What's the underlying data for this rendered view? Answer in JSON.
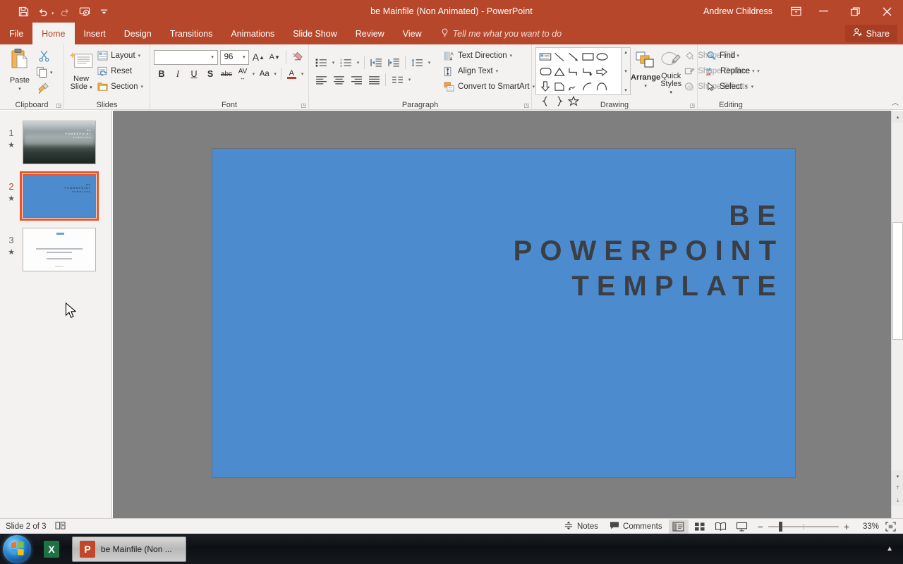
{
  "titlebar": {
    "quick_access": [
      {
        "name": "save-icon",
        "label": "Save"
      },
      {
        "name": "undo-icon",
        "label": "Undo"
      },
      {
        "name": "redo-icon",
        "label": "Redo"
      },
      {
        "name": "start-slideshow-icon",
        "label": "Start From Beginning"
      },
      {
        "name": "customize-qat-icon",
        "label": "Customize Quick Access Toolbar"
      }
    ],
    "document_title": "be Mainfile (Non Animated)",
    "separator": "-",
    "app_name": "PowerPoint",
    "user_name": "Andrew Childress",
    "ribbon_display_options": "Ribbon Display Options",
    "minimize": "Minimize",
    "restore": "Restore Down",
    "close": "Close",
    "accent_color": "#b7472a"
  },
  "tabs": [
    {
      "label": "File",
      "active": false
    },
    {
      "label": "Home",
      "active": true
    },
    {
      "label": "Insert",
      "active": false
    },
    {
      "label": "Design",
      "active": false
    },
    {
      "label": "Transitions",
      "active": false
    },
    {
      "label": "Animations",
      "active": false
    },
    {
      "label": "Slide Show",
      "active": false
    },
    {
      "label": "Review",
      "active": false
    },
    {
      "label": "View",
      "active": false
    }
  ],
  "tell_me": {
    "text": "Tell me what you want to do"
  },
  "share": {
    "label": "Share"
  },
  "ribbon": {
    "clipboard": {
      "group_label": "Clipboard",
      "paste_label": "Paste",
      "cut_label": "Cut",
      "copy_label": "Copy",
      "format_painter_label": "Format Painter"
    },
    "slides": {
      "group_label": "Slides",
      "new_slide_label": "New\nSlide",
      "new_slide_line1": "New",
      "new_slide_line2": "Slide",
      "layout_label": "Layout",
      "reset_label": "Reset",
      "section_label": "Section"
    },
    "font": {
      "group_label": "Font",
      "font_name_value": "",
      "font_size_value": "96",
      "increase_font_label": "A",
      "decrease_font_label": "A",
      "clear_formatting_label": "Clear All Formatting",
      "bold": "B",
      "italic": "I",
      "underline": "U",
      "shadow": "S",
      "strikethrough": "abc",
      "character_spacing": "AV",
      "change_case": "Aa",
      "font_color": "A"
    },
    "paragraph": {
      "group_label": "Paragraph",
      "text_direction_label": "Text Direction",
      "align_text_label": "Align Text",
      "convert_smartart_label": "Convert to SmartArt"
    },
    "drawing": {
      "group_label": "Drawing",
      "arrange_label": "Arrange",
      "quick_styles_line1": "Quick",
      "quick_styles_line2": "Styles",
      "shape_fill_label": "Shape Fill",
      "shape_outline_label": "Shape Outline",
      "shape_effects_label": "Shape Effects"
    },
    "editing": {
      "group_label": "Editing",
      "find_label": "Find",
      "replace_label": "Replace",
      "select_label": "Select"
    },
    "collapse_label": "Collapse the Ribbon"
  },
  "thumbnails": [
    {
      "number": "1",
      "star": "★",
      "selected": false,
      "line1": "BE",
      "line2": "POWERPOINT",
      "line3": "TEMPLATE"
    },
    {
      "number": "2",
      "star": "★",
      "selected": true,
      "line1": "BE",
      "line2": "POWERPOINT",
      "line3": "TEMPLATE"
    },
    {
      "number": "3",
      "star": "★",
      "selected": false,
      "line1": "",
      "line2": "",
      "line3": ""
    }
  ],
  "slide": {
    "background_color": "#4d8bcf",
    "text_color": "#3b3e43",
    "line1": "BE",
    "line2": "POWERPOINT",
    "line3": "TEMPLATE"
  },
  "statusbar": {
    "slide_indicator": "Slide 2 of 3",
    "accessibility_icon": "notes-page-icon",
    "notes_label": "Notes",
    "comments_label": "Comments",
    "view_normal": "Normal View",
    "view_slide_sorter": "Slide Sorter",
    "view_reading": "Reading View",
    "view_slideshow": "Slide Show",
    "zoom_out": "−",
    "zoom_in": "+",
    "zoom_level": "33%",
    "fit_to_window": "Fit slide to current window"
  },
  "taskbar": {
    "start_label": "Start",
    "items": [
      {
        "name": "excel",
        "glyph": "X",
        "label": "",
        "active": false
      },
      {
        "name": "powerpoint",
        "glyph": "P",
        "label": "be Mainfile (Non ...",
        "active": true
      }
    ],
    "show_hidden_icons": "▲"
  }
}
